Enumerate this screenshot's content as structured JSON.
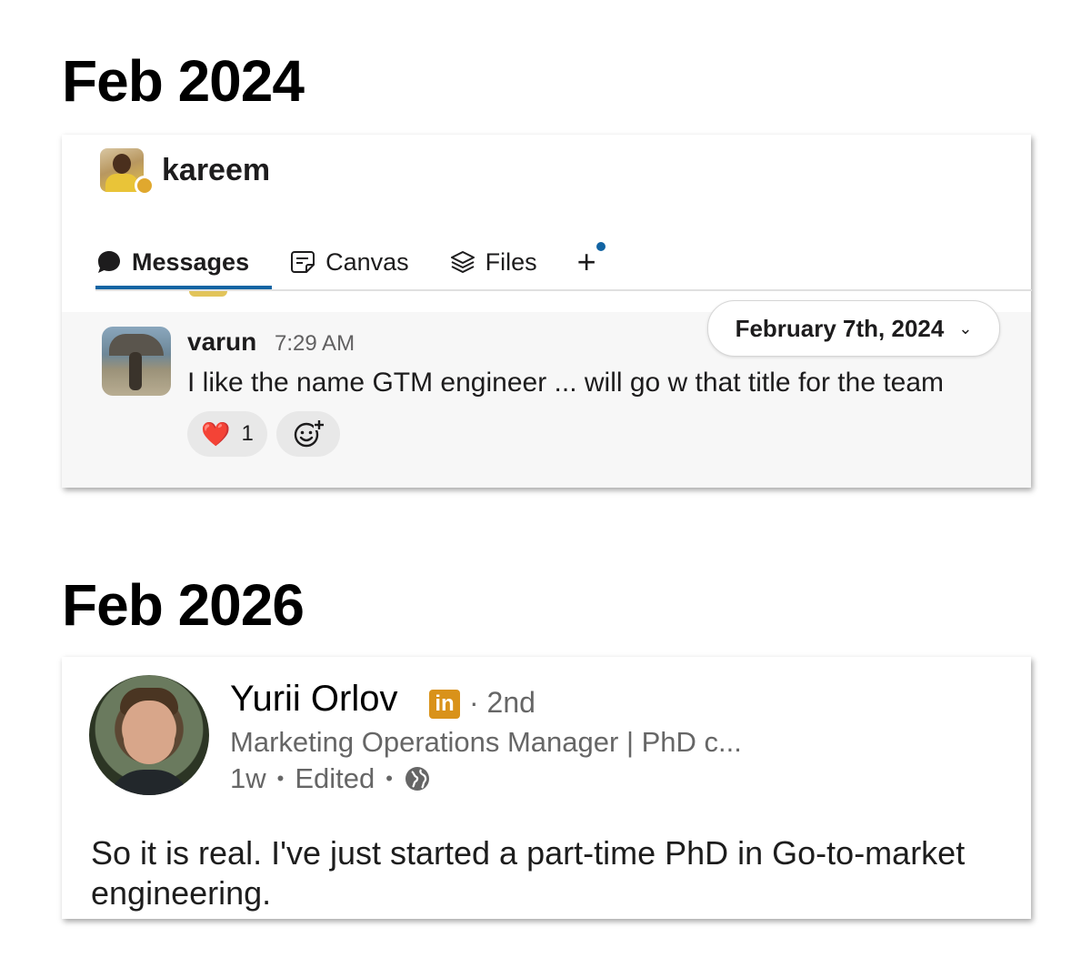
{
  "headings": [
    "Feb 2024",
    "Feb 2026"
  ],
  "slack": {
    "channel_name": "kareem",
    "tabs": [
      {
        "label": "Messages",
        "icon": "chat-bubble-icon",
        "active": true
      },
      {
        "label": "Canvas",
        "icon": "canvas-icon",
        "active": false
      },
      {
        "label": "Files",
        "icon": "layers-icon",
        "active": false
      }
    ],
    "add_tab_label": "+",
    "date_divider": "February 7th, 2024",
    "message": {
      "sender": "varun",
      "time": "7:29 AM",
      "text": "I like the name GTM engineer ... will go w that title for the team",
      "reaction_emoji": "❤️",
      "reaction_count": "1"
    },
    "colors": {
      "accent": "#1264a3",
      "presence": "#e0a82e",
      "reaction_bg": "#e8e8e8"
    }
  },
  "linkedin": {
    "name": "Yurii Orlov",
    "badge": "in",
    "degree": "· 2nd",
    "headline": "Marketing Operations Manager | PhD c...",
    "time": "1w",
    "sep1": "•",
    "edited": "Edited",
    "sep2": "•",
    "visibility_icon": "globe-icon",
    "post_text": "So it is real. I've just started a part-time PhD in Go-to-market engineering.",
    "colors": {
      "badge": "#d9921a",
      "secondary_text": "#666666"
    }
  }
}
